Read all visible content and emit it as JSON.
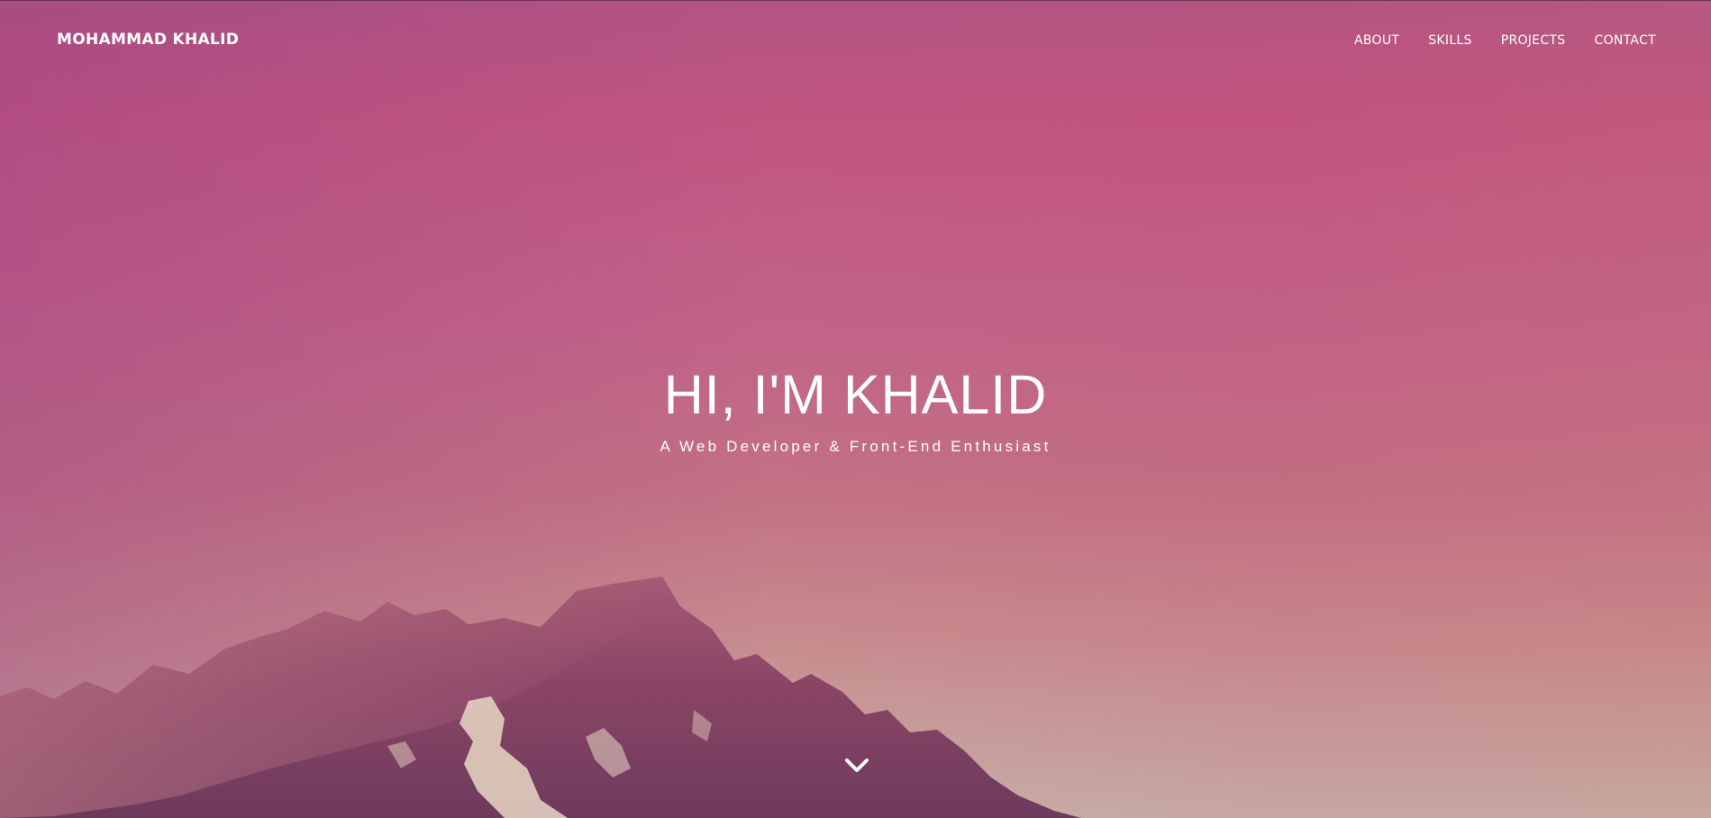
{
  "navbar": {
    "brand": "MOHAMMAD KHALID",
    "links": [
      {
        "label": "ABOUT"
      },
      {
        "label": "SKILLS"
      },
      {
        "label": "PROJECTS"
      },
      {
        "label": "CONTACT"
      }
    ]
  },
  "hero": {
    "title": "HI, I'M KHALID",
    "subtitle": "A Web Developer & Front-End Enthusiast",
    "background_image": "mountain-peak-sunset",
    "scroll_icon": "chevron-down-icon"
  },
  "colors": {
    "sky_top": "#c15580",
    "sky_bottom": "#c6b0a8",
    "text": "#ffffff",
    "mountain": "#7e3f63"
  }
}
